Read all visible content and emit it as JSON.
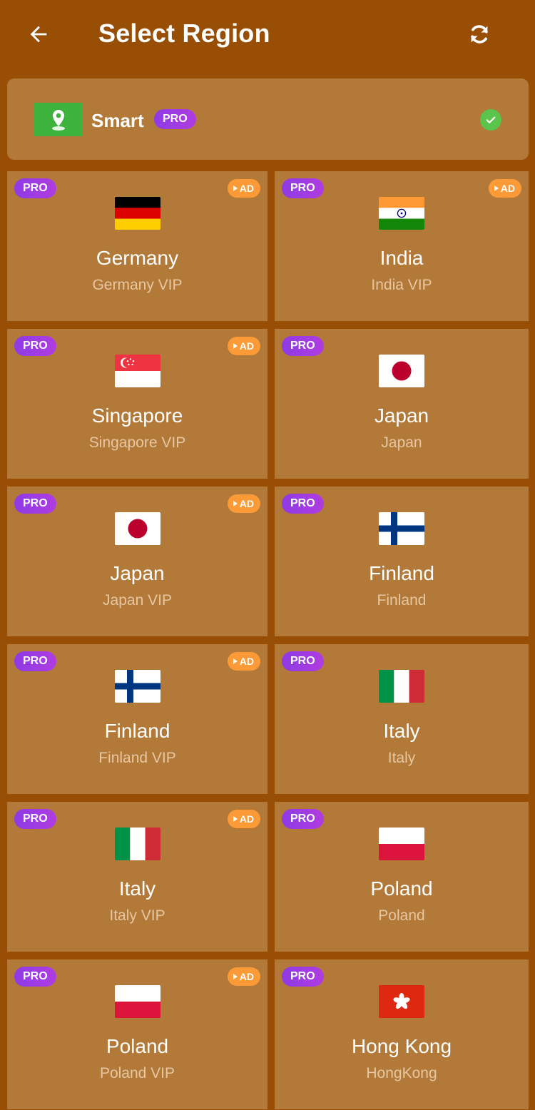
{
  "header": {
    "title": "Select Region",
    "back_icon": "arrow-left-icon",
    "refresh_icon": "refresh-icon"
  },
  "smart": {
    "label": "Smart",
    "badge": "PRO",
    "selected": true,
    "icon": "location-pin-icon"
  },
  "badges": {
    "pro": "PRO",
    "ad": "AD"
  },
  "colors": {
    "background": "#984F05",
    "card": "#B37938",
    "pro_badge": "#9B3CE3",
    "ad_badge": "#FB9A37",
    "check": "#5BC44A",
    "subtitle": "#E6C7A2"
  },
  "regions": [
    {
      "name": "Germany",
      "subtitle": "Germany VIP",
      "flag": "germany",
      "ad": true
    },
    {
      "name": "India",
      "subtitle": "India VIP",
      "flag": "india",
      "ad": true
    },
    {
      "name": "Singapore",
      "subtitle": "Singapore VIP",
      "flag": "singapore",
      "ad": true
    },
    {
      "name": "Japan",
      "subtitle": "Japan",
      "flag": "japan",
      "ad": false
    },
    {
      "name": "Japan",
      "subtitle": "Japan VIP",
      "flag": "japan",
      "ad": true
    },
    {
      "name": "Finland",
      "subtitle": "Finland",
      "flag": "finland",
      "ad": false
    },
    {
      "name": "Finland",
      "subtitle": "Finland VIP",
      "flag": "finland",
      "ad": true
    },
    {
      "name": "Italy",
      "subtitle": "Italy",
      "flag": "italy",
      "ad": false
    },
    {
      "name": "Italy",
      "subtitle": "Italy VIP",
      "flag": "italy",
      "ad": true
    },
    {
      "name": "Poland",
      "subtitle": "Poland",
      "flag": "poland",
      "ad": false
    },
    {
      "name": "Poland",
      "subtitle": "Poland VIP",
      "flag": "poland",
      "ad": true
    },
    {
      "name": "Hong Kong",
      "subtitle": "HongKong",
      "flag": "hongkong",
      "ad": false
    }
  ]
}
